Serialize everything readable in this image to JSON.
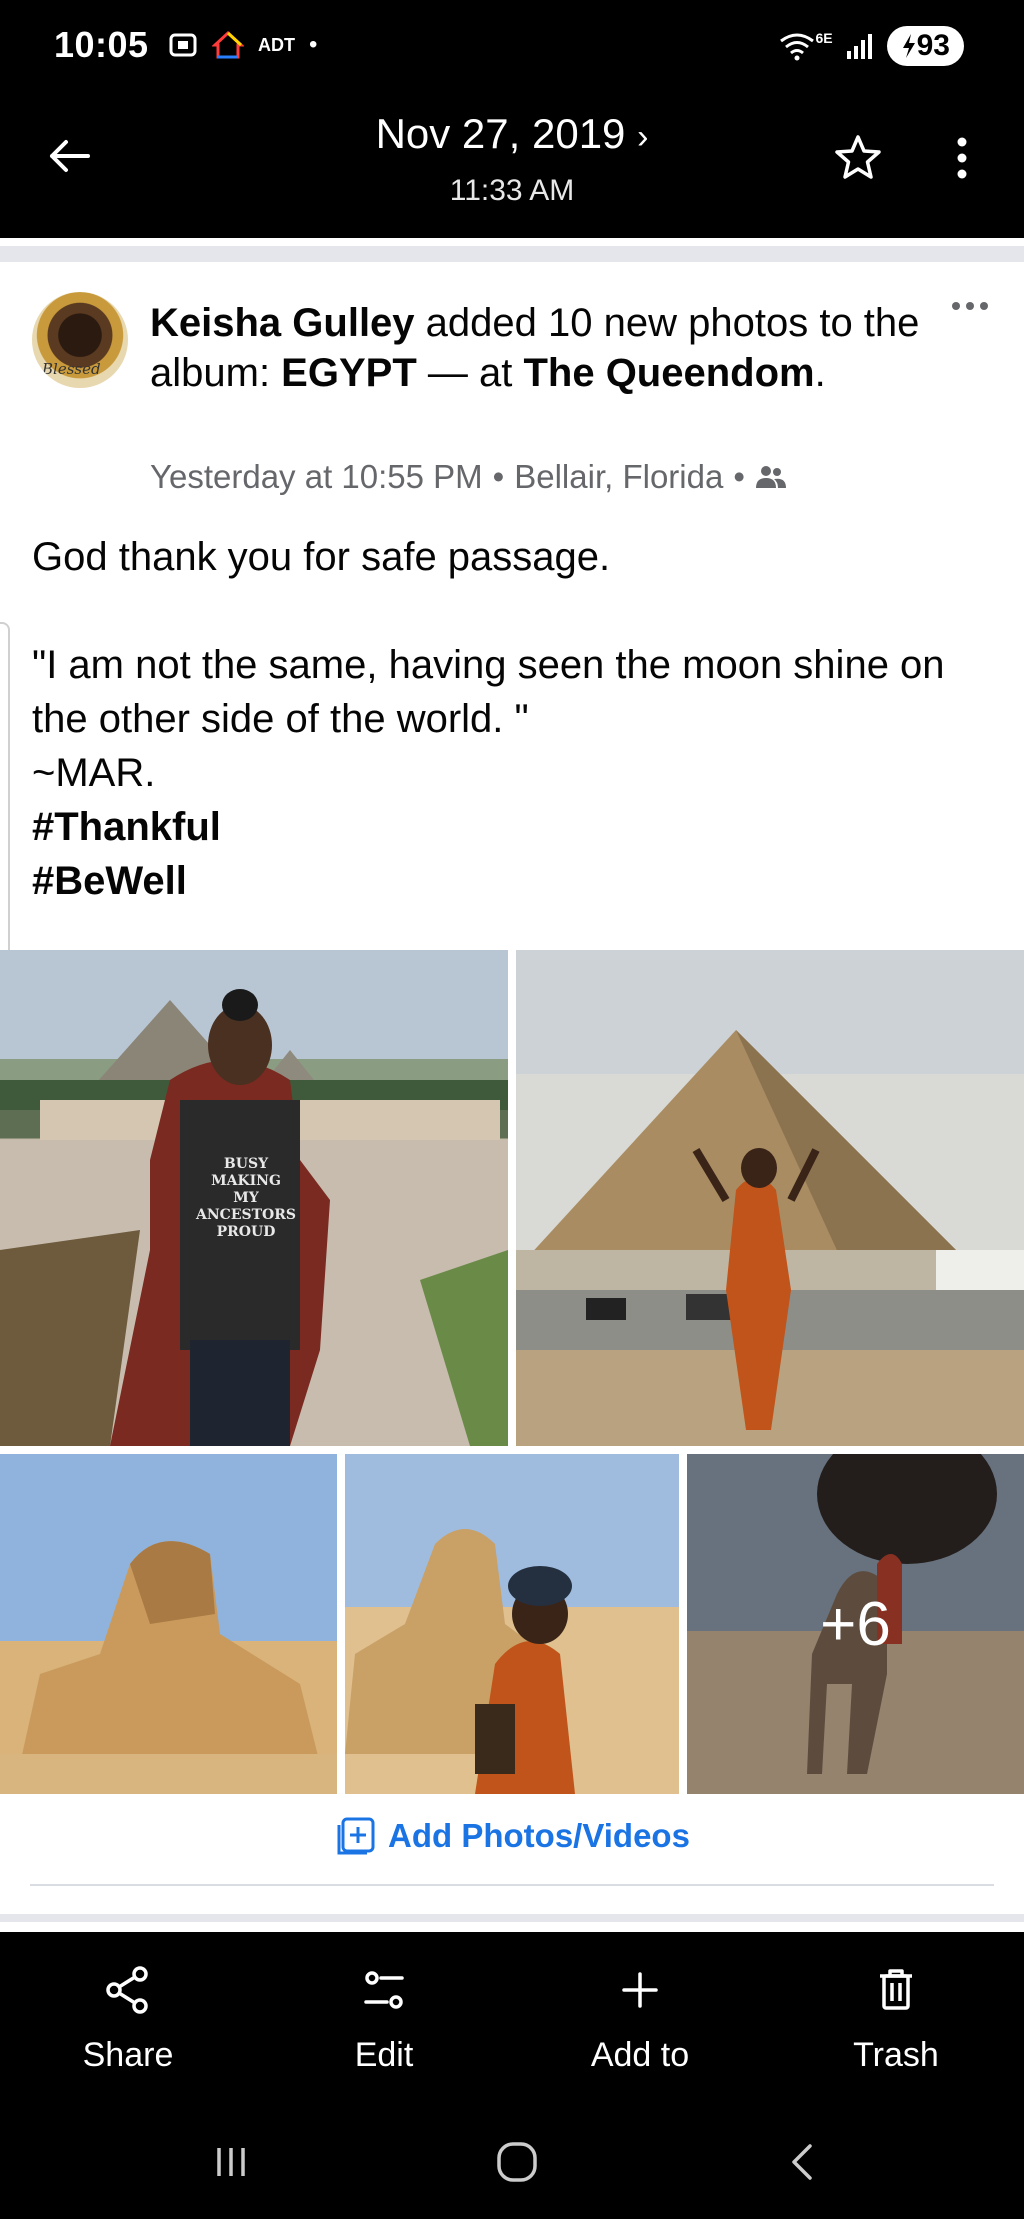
{
  "status_bar": {
    "time": "10:05",
    "adt_label": "ADT",
    "network": "6E",
    "battery": "93"
  },
  "header": {
    "date": "Nov 27, 2019",
    "time": "11:33 AM"
  },
  "post": {
    "author": "Keisha Gulley",
    "action_text": " added 10 new photos to the album: ",
    "album": "EGYPT",
    "at_text": " — at ",
    "place": "The Queendom",
    "period": ".",
    "avatar_caption": "Blessed",
    "meta_time": "Yesterday at 10:55 PM",
    "meta_location": "Bellair, Florida",
    "meta_separator": "•",
    "body_lines": [
      "God thank you for safe passage.",
      "",
      "\"I am not the same, having seen the moon shine on the other side of the world. \"",
      "~MAR."
    ],
    "hashtags": [
      "#Thankful",
      "#BeWell"
    ],
    "photo_more_count": "+6",
    "add_photos_label": "Add Photos/Videos",
    "shirt_text": "BUSY MAKING MY ANCESTORS PROUD"
  },
  "actions": [
    {
      "label": "Share",
      "icon": "share-icon"
    },
    {
      "label": "Edit",
      "icon": "edit-icon"
    },
    {
      "label": "Add to",
      "icon": "plus-icon"
    },
    {
      "label": "Trash",
      "icon": "trash-icon"
    }
  ],
  "colors": {
    "link_blue": "#1b74e4",
    "meta_gray": "#65676b",
    "text": "#050505"
  }
}
